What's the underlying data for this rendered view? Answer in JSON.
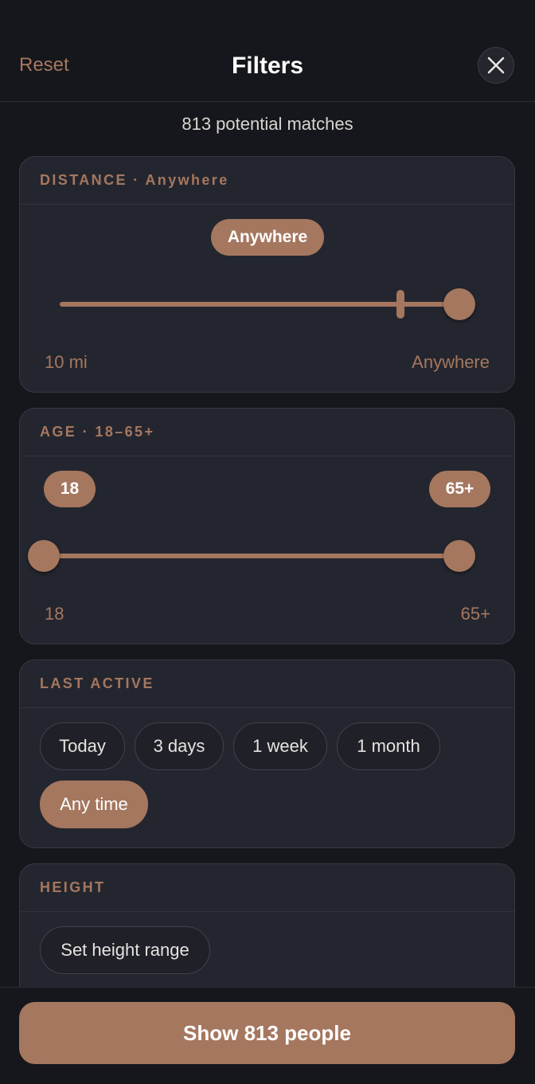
{
  "header": {
    "reset_label": "Reset",
    "title": "Filters",
    "close_icon": "close-icon"
  },
  "summary": {
    "matches_text": "813 potential matches"
  },
  "distance": {
    "heading": "DISTANCE · Anywhere",
    "value_pill": "Anywhere",
    "min_label": "10 mi",
    "max_label": "Anywhere",
    "slider_fraction": 1.0
  },
  "age": {
    "heading": "AGE · 18–65+",
    "min_pill": "18",
    "max_pill": "65+",
    "min_label": "18",
    "max_label": "65+",
    "selected_min_fraction": 0.0,
    "selected_max_fraction": 1.0
  },
  "last_active": {
    "heading": "LAST ACTIVE",
    "options": [
      "Today",
      "3 days",
      "1 week",
      "1 month",
      "Any time"
    ],
    "selected": "Any time"
  },
  "height": {
    "heading": "HEIGHT",
    "button_label": "Set height range"
  },
  "footer": {
    "show_button": "Show 813 people"
  },
  "colors": {
    "accent": "#a5775f",
    "background": "#16171c",
    "card": "#24262f"
  }
}
